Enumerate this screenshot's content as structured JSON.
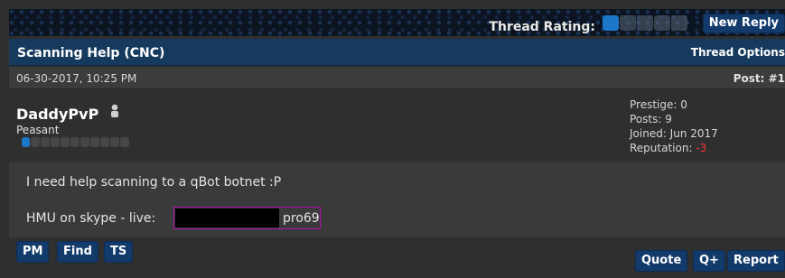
{
  "header": {
    "thread_rating_label": "Thread Rating:",
    "rating_pips": [
      true,
      false,
      false,
      false,
      false
    ],
    "new_reply_label": "New Reply"
  },
  "thread": {
    "title": "Scanning Help (CNC)",
    "options_label": "Thread Options"
  },
  "post": {
    "date": "06-30-2017, 10:25 PM",
    "number": "Post: #1",
    "username": "DaddyPvP",
    "user_title": "Peasant",
    "stats": {
      "prestige": "Prestige: 0",
      "posts": "Posts: 9",
      "joined": "Joined: Jun 2017",
      "reputation_label": "Reputation: ",
      "reputation_value": "-3"
    },
    "message_line1": "I need help scanning to a qBot botnet :P",
    "message_line2_prefix": "HMU on skype - live:",
    "message_line2_suffix": "pro69"
  },
  "actions": {
    "pm": "PM",
    "find": "Find",
    "ts": "TS",
    "quote": "Quote",
    "quick_quote": "Q+",
    "report": "Report"
  },
  "colors": {
    "accent": "#1d77c8",
    "header_bg": "#153a5d",
    "button_bg": "#123a6b",
    "negative": "#ff3333",
    "redact_border": "#b10fb1"
  }
}
